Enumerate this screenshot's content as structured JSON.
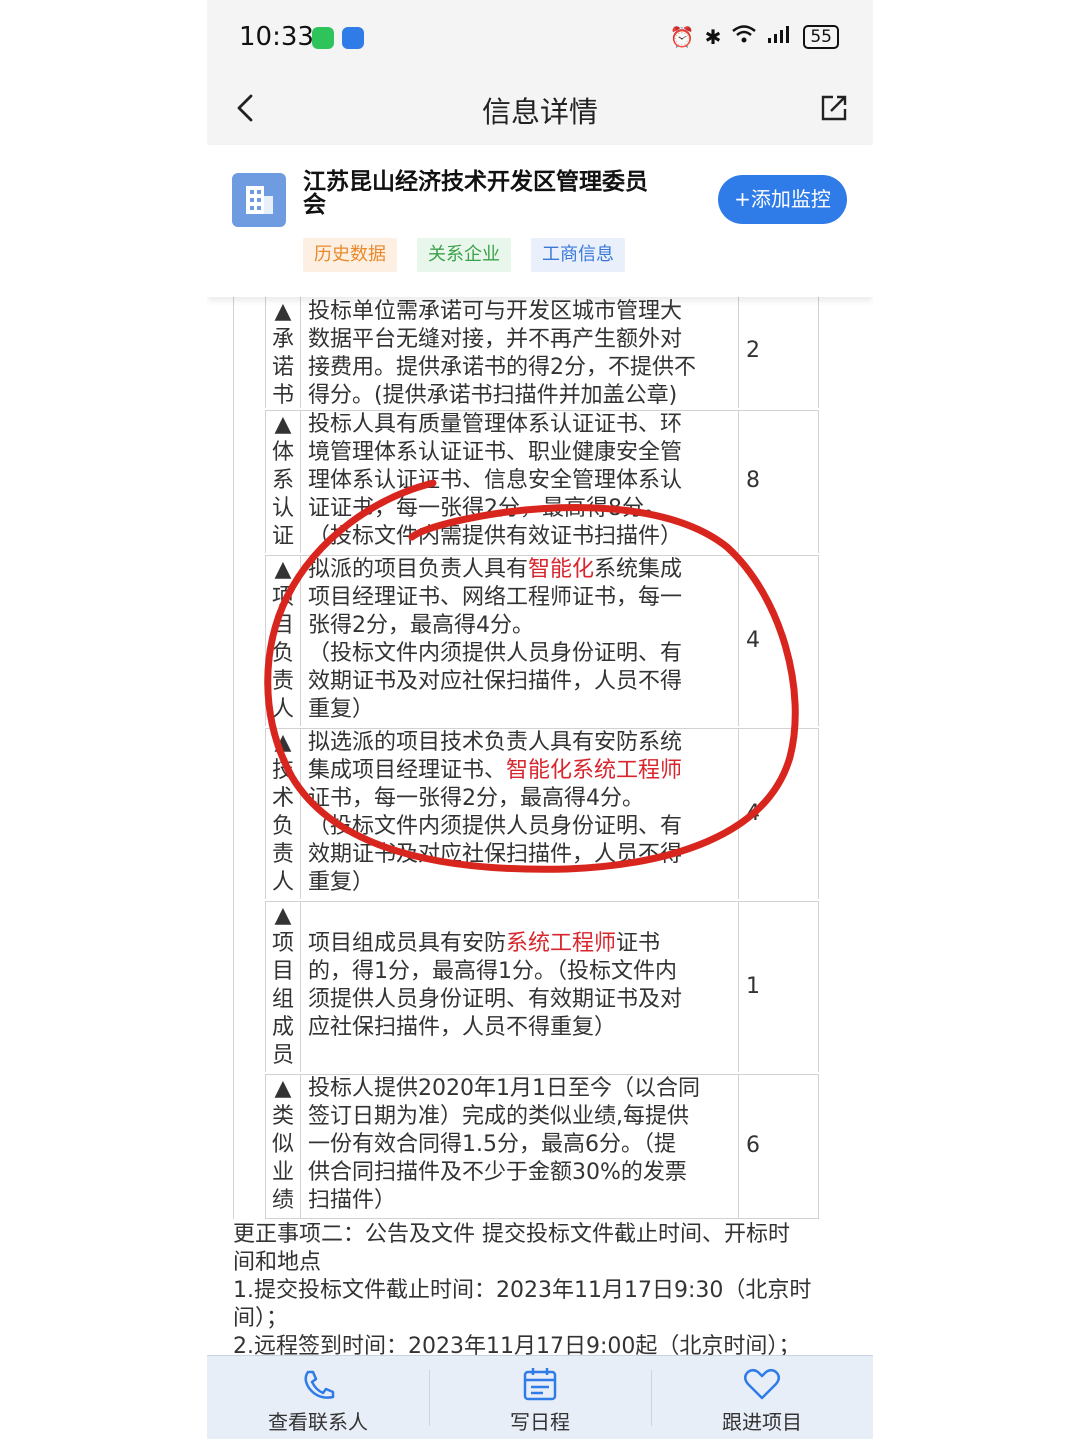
{
  "status": {
    "time": "10:33",
    "battery": "55"
  },
  "nav": {
    "title": "信息详情"
  },
  "company": {
    "name_line1": "江苏昆山经济技术开发区管理委员",
    "name_line2": "会",
    "add_button": "+添加监控",
    "tags": [
      "历史数据",
      "关系企业",
      "工商信息"
    ]
  },
  "rows": [
    {
      "label": "▲承诺书",
      "label_chars": [
        "▲",
        "承",
        "诺",
        "书"
      ],
      "lines": [
        "投标单位需承诺可与开发区城市管理大",
        "数据平台无缝对接，并不再产生额外对",
        "接费用。提供承诺书的得2分，不提供不",
        "得分。(提供承诺书扫描件并加盖公章)"
      ],
      "score": "2"
    },
    {
      "label": "▲体系认证",
      "label_chars": [
        "▲",
        "体",
        "系",
        "认",
        "证"
      ],
      "lines": [
        "投标人具有质量管理体系认证证书、环",
        "境管理体系认证证书、职业健康安全管",
        "理体系认证证书、信息安全管理体系认",
        "证证书，每一张得2分，最高得8分。",
        "（投标文件内需提供有效证书扫描件）"
      ],
      "score": "8"
    },
    {
      "label": "▲项目负责人",
      "label_chars": [
        "▲",
        "项",
        "目",
        "负",
        "责",
        "人"
      ],
      "line1_pre": "拟派的项目负责人具有",
      "line1_red": "智能化",
      "line1_post": "系统集成",
      "lines": [
        "项目经理证书、网络工程师证书，每一",
        "张得2分，最高得4分。",
        "（投标文件内须提供人员身份证明、有",
        "效期证书及对应社保扫描件，人员不得",
        "重复）"
      ],
      "score": "4"
    },
    {
      "label": "▲技术负责人",
      "label_chars": [
        "▲",
        "技",
        "术",
        "负",
        "责",
        "人"
      ],
      "line1": "拟选派的项目技术负责人具有安防系统",
      "line2_pre": "集成项目经理证书、",
      "line2_red": "智能化系统工程师",
      "lines": [
        "证书，每一张得2分，最高得4分。",
        "（投标文件内须提供人员身份证明、有",
        "效期证书及对应社保扫描件，人员不得",
        "重复）"
      ],
      "score": "4"
    },
    {
      "label": "▲项目组成员",
      "label_chars": [
        "▲",
        "项",
        "目",
        "组",
        "成",
        "员"
      ],
      "line1_pre": "项目组成员具有安防",
      "line1_red": "系统工程师",
      "line1_post": "证书",
      "lines": [
        "的，得1分，最高得1分。（投标文件内",
        "须提供人员身份证明、有效期证书及对",
        "应社保扫描件，人员不得重复）"
      ],
      "score": "1"
    },
    {
      "label": "▲类似业绩",
      "label_chars": [
        "▲",
        "类",
        "似",
        "业",
        "绩"
      ],
      "lines": [
        "投标人提供2020年1月1日至今（以合同",
        "签订日期为准）完成的类似业绩,每提供",
        "一份有效合同得1.5分，最高6分。（提",
        "供合同扫描件及不少于金额30%的发票",
        "扫描件）"
      ],
      "score": "6"
    }
  ],
  "paragraphs": [
    "更正事项二：公告及文件 提交投标文件截止时间、开标时",
    "间和地点",
    "1.提交投标文件截止时间：2023年11月17日9:30（北京时",
    "间）；",
    "2.远程签到时间：2023年11月17日9:00起（北京时间）；"
  ],
  "bottom": {
    "contact": "查看联系人",
    "schedule": "写日程",
    "follow": "跟进项目"
  },
  "colors": {
    "accent": "#2f7be8",
    "highlight_red": "#d8262e",
    "annotation": "#d8261f"
  }
}
